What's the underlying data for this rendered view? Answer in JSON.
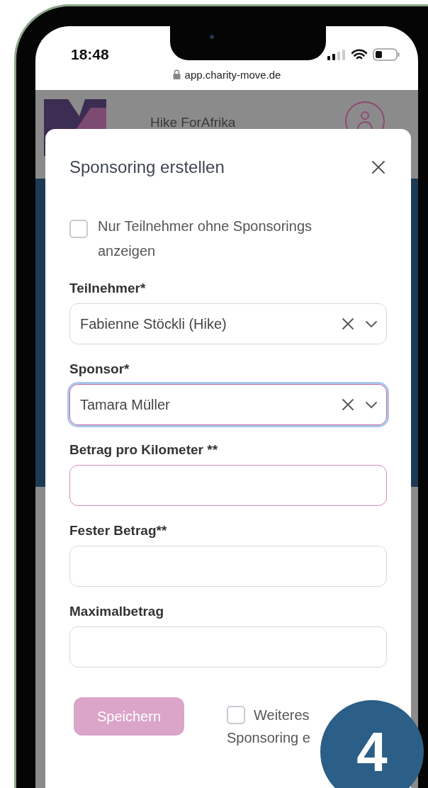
{
  "status_bar": {
    "time": "18:48",
    "url": "app.charity-move.de"
  },
  "app_header": {
    "title": "Hike ForAfrika"
  },
  "dialog": {
    "title": "Sponsoring erstellen",
    "filter": {
      "label": "Nur Teilnehmer ohne Sponsorings anzeigen",
      "checked": false
    },
    "fields": [
      {
        "kind": "select",
        "label": "Teilnehmer*",
        "value": "Fabienne Stöckli (Hike)",
        "focused": false,
        "invalid": false
      },
      {
        "kind": "select",
        "label": "Sponsor*",
        "value": "Tamara Müller",
        "focused": true,
        "invalid": false
      },
      {
        "kind": "text",
        "label": "Betrag pro Kilometer **",
        "focused": false,
        "invalid": true
      },
      {
        "kind": "text",
        "label": "Fester Betrag**",
        "focused": false,
        "invalid": false
      },
      {
        "kind": "text",
        "label": "Maximalbetrag",
        "focused": false,
        "invalid": false
      }
    ],
    "save_button": {
      "label": "Speichern",
      "disabled": true
    },
    "another": {
      "label_line1": "Weiteres",
      "label_line2": "Sponsoring e",
      "checked": false
    }
  },
  "step_badge": "4"
}
